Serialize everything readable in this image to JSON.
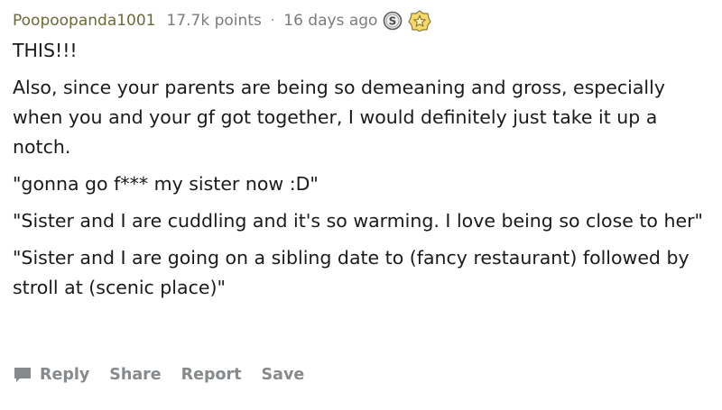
{
  "comment": {
    "author": "Poopoopanda1001",
    "points": "17.7k points",
    "separator": "·",
    "time": "16 days ago",
    "award_icons": [
      "silver-award-icon",
      "helpful-award-icon"
    ],
    "paragraphs": [
      "THIS!!!",
      "Also, since your parents are being so demeaning and gross, especially when you and your gf got together, I would definitely just take it up a notch.",
      "\"gonna go f*** my sister now :D\"",
      "\"Sister and I are cuddling and it's so warming. I love being so close to her\"",
      "\"Sister and I are going on a sibling date to (fancy restaurant) followed by stroll at (scenic place)\""
    ]
  },
  "actions": {
    "reply": "Reply",
    "share": "Share",
    "report": "Report",
    "save": "Save",
    "reply_icon": "comment-bubble-icon"
  },
  "colors": {
    "author": "#6b6b3a",
    "meta": "#7c7c7c",
    "body_text": "#1a1a1a",
    "action_text": "#878a8c",
    "award_gold": "#e6c84a"
  }
}
